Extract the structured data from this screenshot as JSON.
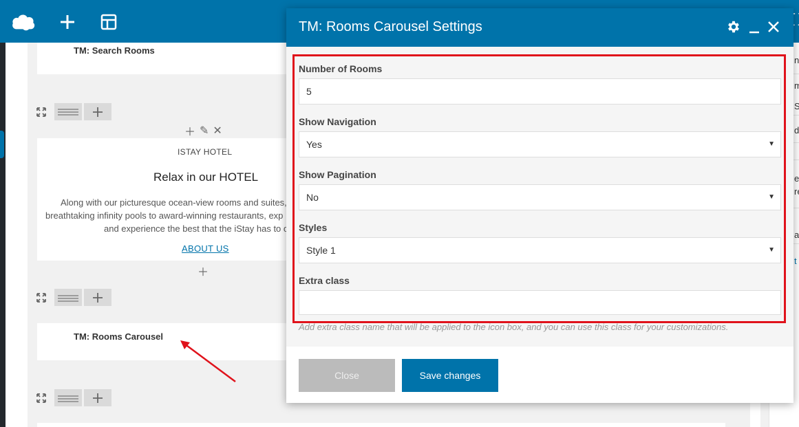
{
  "toolbar": {
    "logo_icon": "cloud-logo-icon",
    "add_icon": "plus-icon",
    "layout_icon": "layout-icon"
  },
  "canvas": {
    "search_rooms_label": "TM: Search Rooms",
    "hotel_subtitle": "ISTAY HOTEL",
    "hotel_title": "Relax in our HOTEL",
    "hotel_text_lines": [
      "Along with our picturesque ocean-view rooms and suites,",
      "breathtaking infinity pools to award-winning restaurants, exp",
      "and experience the best that the iStay has to o"
    ],
    "hotel_link": "ABOUT US",
    "rooms_carousel_label": "TM: Rooms Carousel"
  },
  "side_panel": {
    "fragments": [
      "ne",
      "m",
      "Sl",
      "d",
      "ee",
      "re",
      "a",
      "t"
    ]
  },
  "modal": {
    "title": "TM: Rooms Carousel Settings",
    "fields": {
      "number_of_rooms": {
        "label": "Number of Rooms",
        "value": "5"
      },
      "show_navigation": {
        "label": "Show Navigation",
        "value": "Yes"
      },
      "show_pagination": {
        "label": "Show Pagination",
        "value": "No"
      },
      "styles": {
        "label": "Styles",
        "value": "Style 1"
      },
      "extra_class": {
        "label": "Extra class",
        "value": ""
      }
    },
    "hint": "Add extra class name that will be applied to the icon box, and you can use this class for your customizations.",
    "close_label": "Close",
    "save_label": "Save changes"
  },
  "colors": {
    "brand": "#0073aa",
    "highlight": "#e0121b",
    "button_disabled": "#bbbbbb"
  }
}
